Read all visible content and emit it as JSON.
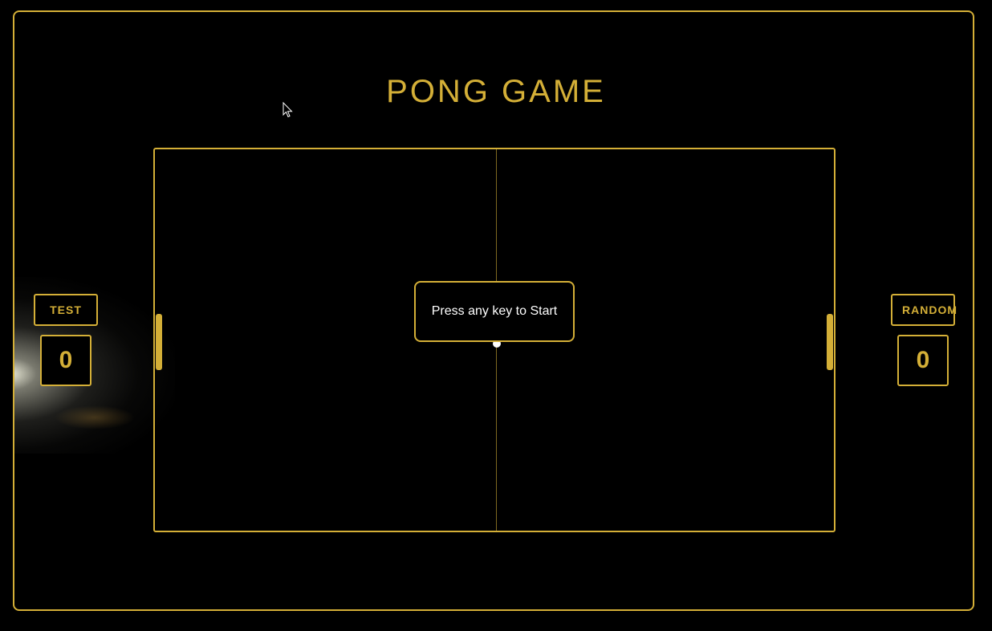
{
  "game": {
    "title": "PONG GAME",
    "start_message": "Press any key to Start"
  },
  "players": {
    "left": {
      "name": "TEST",
      "score": "0"
    },
    "right": {
      "name": "RANDOM",
      "score": "0"
    }
  },
  "colors": {
    "accent": "#d4af37",
    "background": "#000000",
    "ball": "#ffffff",
    "text": "#ffffff"
  },
  "icons": {
    "cursor": "mouse-pointer-icon"
  }
}
